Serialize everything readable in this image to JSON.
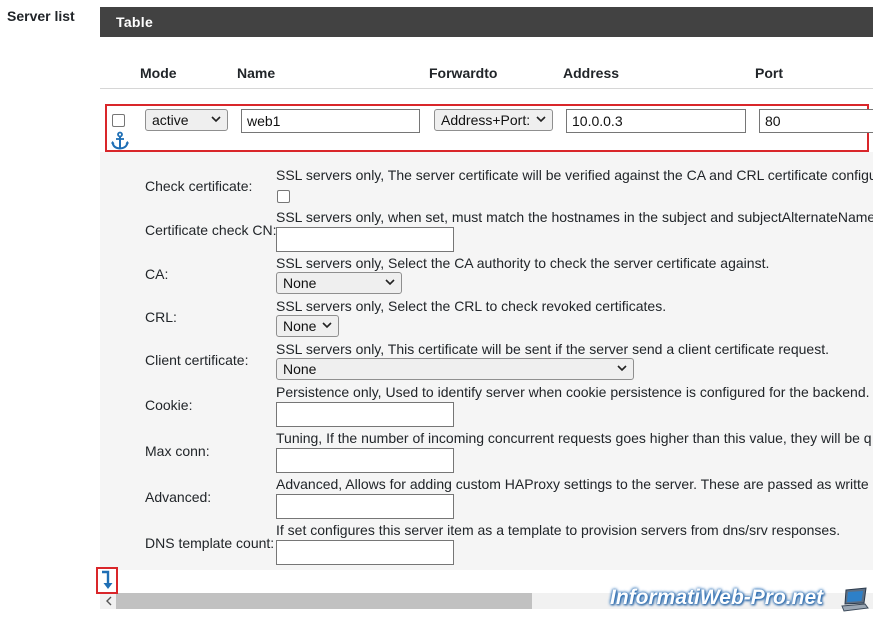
{
  "section": {
    "label": "Server list"
  },
  "panel": {
    "title": "Table"
  },
  "columns": [
    "Mode",
    "Name",
    "Forwardto",
    "Address",
    "Port"
  ],
  "server_row": {
    "mode": "active",
    "name": "web1",
    "forwardto": "Address+Port:",
    "address": "10.0.0.3",
    "port": "80",
    "icon": "anchor-icon"
  },
  "details": {
    "check_certificate": {
      "label": "Check certificate:",
      "desc": "SSL servers only, The server certificate will be verified against the CA and CRL certificate configu"
    },
    "cert_check_cn": {
      "label": "Certificate check CN:",
      "desc": "SSL servers only, when set, must match the hostnames in the subject and subjectAlternateName",
      "value": ""
    },
    "ca": {
      "label": "CA:",
      "desc": "SSL servers only, Select the CA authority to check the server certificate against.",
      "value": "None"
    },
    "crl": {
      "label": "CRL:",
      "desc": "SSL servers only, Select the CRL to check revoked certificates.",
      "value": "None"
    },
    "client_certificate": {
      "label": "Client certificate:",
      "desc": "SSL servers only, This certificate will be sent if the server send a client certificate request.",
      "value": "None"
    },
    "cookie": {
      "label": "Cookie:",
      "desc": "Persistence only, Used to identify server when cookie persistence is configured for the backend.",
      "value": ""
    },
    "max_conn": {
      "label": "Max conn:",
      "desc": "Tuning, If the number of incoming concurrent requests goes higher than this value, they will be q",
      "value": ""
    },
    "advanced": {
      "label": "Advanced:",
      "desc": "Advanced, Allows for adding custom HAProxy settings to the server. These are passed as writte",
      "value": ""
    },
    "dns_template_count": {
      "label": "DNS template count:",
      "desc": "If set configures this server item as a template to provision servers from dns/srv responses.",
      "value": ""
    }
  },
  "watermark": "InformatiWeb-Pro.net",
  "colors": {
    "header_bg": "#424242",
    "highlight": "#d9262a",
    "accent_blue": "#1f6fb5"
  }
}
